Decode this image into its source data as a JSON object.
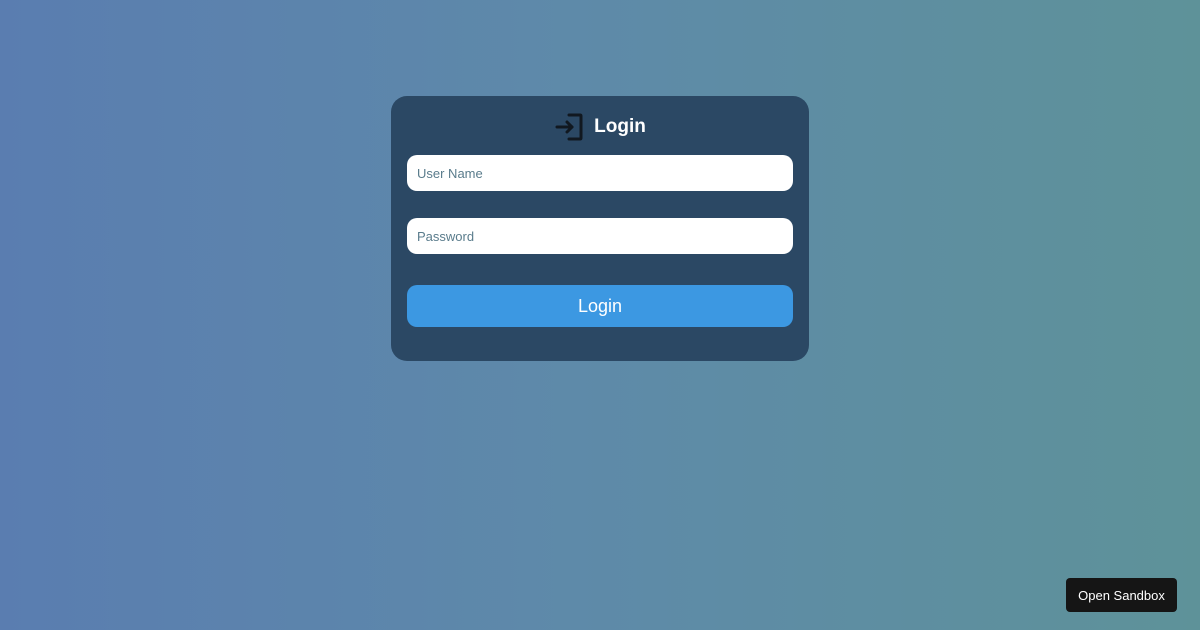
{
  "login_form": {
    "title": "Login",
    "icon": "login-icon",
    "username_placeholder": "User Name",
    "username_value": "",
    "password_placeholder": "Password",
    "password_value": "",
    "submit_label": "Login"
  },
  "sandbox": {
    "button_label": "Open Sandbox"
  },
  "colors": {
    "card_background": "#2b4864",
    "primary_button": "#3c98e2",
    "background_start": "#5a7db0",
    "background_end": "#5e9299"
  }
}
